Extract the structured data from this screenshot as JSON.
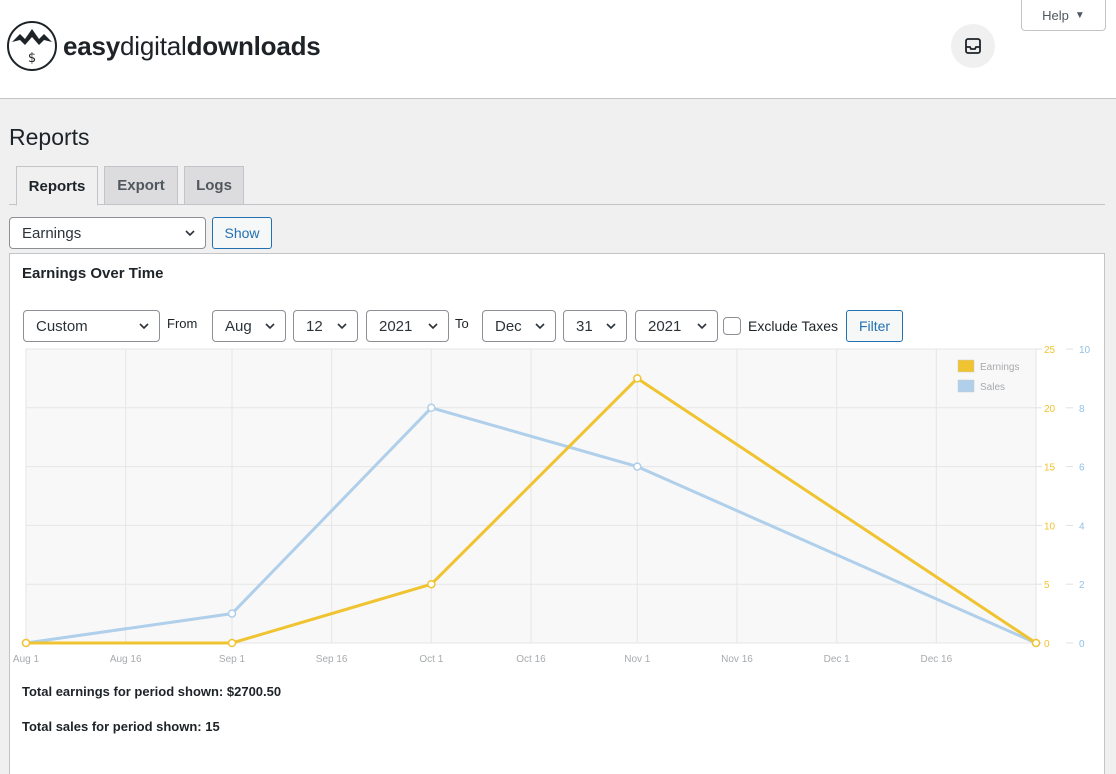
{
  "header": {
    "logo": {
      "part1": "easy",
      "part2": "digital",
      "part3": "downloads"
    },
    "help_label": "Help",
    "help_arrow": "▼",
    "inbox_icon": "inbox-tray-icon"
  },
  "page": {
    "title": "Reports"
  },
  "tabs": [
    {
      "label": "Reports",
      "active": true
    },
    {
      "label": "Export",
      "active": false
    },
    {
      "label": "Logs",
      "active": false
    }
  ],
  "report_select": {
    "value": "Earnings"
  },
  "show_button": "Show",
  "panel": {
    "title": "Earnings Over Time",
    "range_select": "Custom",
    "from_label": "From",
    "from_month": "Aug",
    "from_day": "12",
    "from_year": "2021",
    "to_label": "To",
    "to_month": "Dec",
    "to_day": "31",
    "to_year": "2021",
    "exclude_taxes_label": "Exclude Taxes",
    "exclude_taxes_checked": false,
    "filter_button": "Filter"
  },
  "totals": {
    "earnings_text": "Total earnings for period shown: $2700.50",
    "sales_text": "Total sales for period shown: 15"
  },
  "colors": {
    "earnings": "#f0c330",
    "sales": "#afcfea",
    "accent": "#2271b1"
  },
  "chart_data": {
    "type": "line",
    "x_ticks": [
      "Aug 1",
      "Aug 16",
      "Sep 1",
      "Sep 16",
      "Oct 1",
      "Oct 16",
      "Nov 1",
      "Nov 16",
      "Dec 1",
      "Dec 16"
    ],
    "x": [
      "Aug 1",
      "Sep 1",
      "Oct 1",
      "Nov 1",
      "Dec 31"
    ],
    "series": [
      {
        "name": "Earnings",
        "axis": "left",
        "values": [
          0,
          0,
          5,
          22.5,
          0
        ]
      },
      {
        "name": "Sales",
        "axis": "right",
        "values": [
          0,
          1,
          8,
          6,
          0
        ]
      }
    ],
    "y_left_ticks": [
      "0",
      "5",
      "10",
      "15",
      "20",
      "25"
    ],
    "y_right_ticks": [
      "0",
      "2",
      "4",
      "6",
      "8",
      "10"
    ],
    "y_left_range": [
      0,
      25
    ],
    "y_right_range": [
      0,
      10
    ],
    "grid": true,
    "legend_position": "top-right"
  }
}
